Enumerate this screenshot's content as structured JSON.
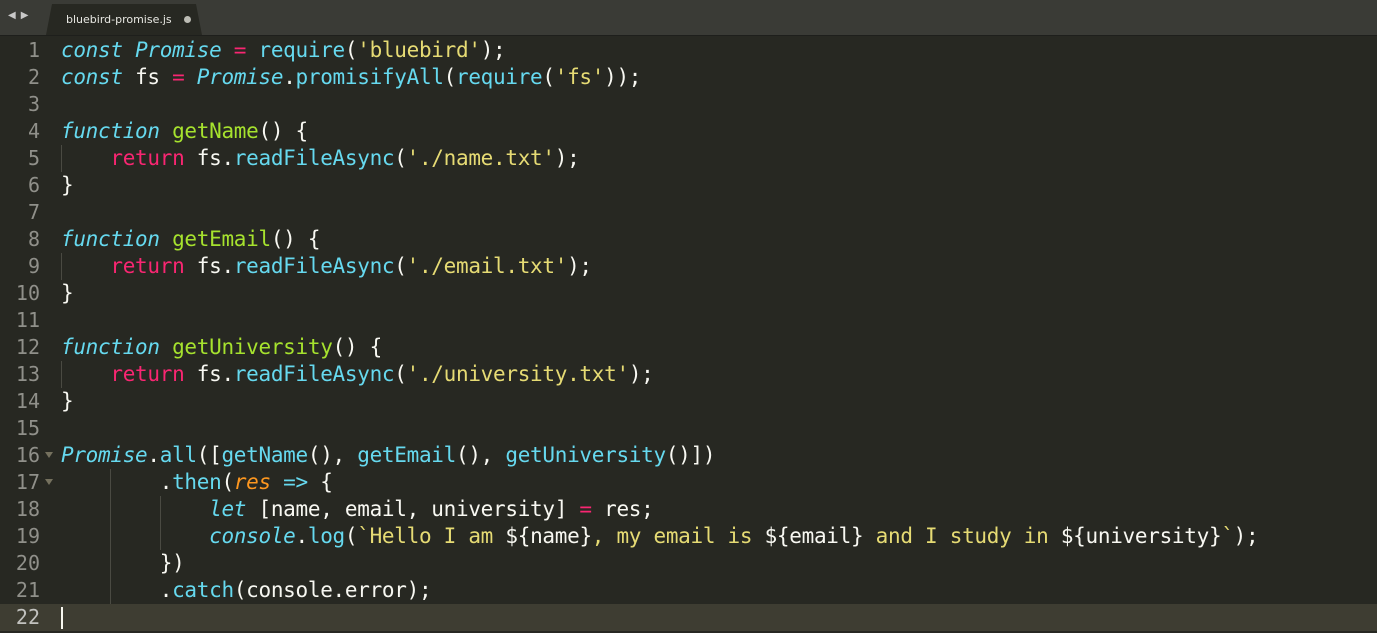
{
  "tabbar": {
    "nav_left_icon": "arrow-left-icon",
    "nav_right_icon": "arrow-right-icon",
    "tab_label": "bluebird-promise.js",
    "dirty_indicator_icon": "unsaved-dot-icon"
  },
  "theme": {
    "background": "#272822",
    "keyword": "#66d9ef",
    "control": "#f92672",
    "string": "#e6db74",
    "function": "#a6e22e",
    "parameter": "#fd971f",
    "text": "#f8f8f2"
  },
  "editor": {
    "current_line": 22,
    "lines": [
      {
        "number": "1",
        "indent": 0,
        "tokens": [
          [
            "const ",
            "kw"
          ],
          [
            "Promise",
            "sup"
          ],
          [
            " = ",
            "op"
          ],
          [
            "require",
            "fn"
          ],
          [
            "(",
            "p"
          ],
          [
            "'bluebird'",
            "str"
          ],
          [
            ");",
            "p"
          ]
        ]
      },
      {
        "number": "2",
        "indent": 0,
        "tokens": [
          [
            "const ",
            "kw"
          ],
          [
            "fs",
            "p"
          ],
          [
            " = ",
            "op"
          ],
          [
            "Promise",
            "sup"
          ],
          [
            ".",
            "p"
          ],
          [
            "promisifyAll",
            "fn"
          ],
          [
            "(",
            "p"
          ],
          [
            "require",
            "fn"
          ],
          [
            "(",
            "p"
          ],
          [
            "'fs'",
            "str"
          ],
          [
            "));",
            "p"
          ]
        ]
      },
      {
        "number": "3",
        "indent": 0,
        "tokens": []
      },
      {
        "number": "4",
        "indent": 0,
        "tokens": [
          [
            "function ",
            "kw"
          ],
          [
            "getName",
            "def"
          ],
          [
            "() {",
            "p"
          ]
        ]
      },
      {
        "number": "5",
        "indent": 1,
        "tokens": [
          [
            "    ",
            "p"
          ],
          [
            "return ",
            "ctl"
          ],
          [
            "fs",
            "p"
          ],
          [
            ".",
            "p"
          ],
          [
            "readFileAsync",
            "fn"
          ],
          [
            "(",
            "p"
          ],
          [
            "'./name.txt'",
            "str"
          ],
          [
            ");",
            "p"
          ]
        ]
      },
      {
        "number": "6",
        "indent": 0,
        "tokens": [
          [
            "}",
            "p"
          ]
        ]
      },
      {
        "number": "7",
        "indent": 0,
        "tokens": []
      },
      {
        "number": "8",
        "indent": 0,
        "tokens": [
          [
            "function ",
            "kw"
          ],
          [
            "getEmail",
            "def"
          ],
          [
            "() {",
            "p"
          ]
        ]
      },
      {
        "number": "9",
        "indent": 1,
        "tokens": [
          [
            "    ",
            "p"
          ],
          [
            "return ",
            "ctl"
          ],
          [
            "fs",
            "p"
          ],
          [
            ".",
            "p"
          ],
          [
            "readFileAsync",
            "fn"
          ],
          [
            "(",
            "p"
          ],
          [
            "'./email.txt'",
            "str"
          ],
          [
            ");",
            "p"
          ]
        ]
      },
      {
        "number": "10",
        "indent": 0,
        "tokens": [
          [
            "}",
            "p"
          ]
        ]
      },
      {
        "number": "11",
        "indent": 0,
        "tokens": []
      },
      {
        "number": "12",
        "indent": 0,
        "tokens": [
          [
            "function ",
            "kw"
          ],
          [
            "getUniversity",
            "def"
          ],
          [
            "() {",
            "p"
          ]
        ]
      },
      {
        "number": "13",
        "indent": 1,
        "tokens": [
          [
            "    ",
            "p"
          ],
          [
            "return ",
            "ctl"
          ],
          [
            "fs",
            "p"
          ],
          [
            ".",
            "p"
          ],
          [
            "readFileAsync",
            "fn"
          ],
          [
            "(",
            "p"
          ],
          [
            "'./university.txt'",
            "str"
          ],
          [
            ");",
            "p"
          ]
        ]
      },
      {
        "number": "14",
        "indent": 0,
        "tokens": [
          [
            "}",
            "p"
          ]
        ]
      },
      {
        "number": "15",
        "indent": 0,
        "tokens": []
      },
      {
        "number": "16",
        "indent": 0,
        "fold": true,
        "tokens": [
          [
            "Promise",
            "sup"
          ],
          [
            ".",
            "p"
          ],
          [
            "all",
            "fn"
          ],
          [
            "([",
            "p"
          ],
          [
            "getName",
            "fn"
          ],
          [
            "(), ",
            "p"
          ],
          [
            "getEmail",
            "fn"
          ],
          [
            "(), ",
            "p"
          ],
          [
            "getUniversity",
            "fn"
          ],
          [
            "()])",
            "p"
          ]
        ]
      },
      {
        "number": "17",
        "indent": 1,
        "fold": true,
        "tokens": [
          [
            "        ",
            "p"
          ],
          [
            ".",
            "p"
          ],
          [
            "then",
            "fn"
          ],
          [
            "(",
            "p"
          ],
          [
            "res",
            "param"
          ],
          [
            " => ",
            "kw"
          ],
          [
            "{",
            "p"
          ]
        ]
      },
      {
        "number": "18",
        "indent": 2,
        "tokens": [
          [
            "            ",
            "p"
          ],
          [
            "let ",
            "kw"
          ],
          [
            "[name, email, university] ",
            "p"
          ],
          [
            "= ",
            "op"
          ],
          [
            "res;",
            "p"
          ]
        ]
      },
      {
        "number": "19",
        "indent": 2,
        "tokens": [
          [
            "            ",
            "p"
          ],
          [
            "console",
            "sup"
          ],
          [
            ".",
            "p"
          ],
          [
            "log",
            "fn"
          ],
          [
            "(",
            "p"
          ],
          [
            "`Hello I am ",
            "str"
          ],
          [
            "${",
            "p"
          ],
          [
            "name",
            "p"
          ],
          [
            "}",
            "p"
          ],
          [
            ", my email is ",
            "str"
          ],
          [
            "${",
            "p"
          ],
          [
            "email",
            "p"
          ],
          [
            "}",
            "p"
          ],
          [
            " and I study in ",
            "str"
          ],
          [
            "${",
            "p"
          ],
          [
            "university",
            "p"
          ],
          [
            "}",
            "p"
          ],
          [
            "`",
            "str"
          ],
          [
            ");",
            "p"
          ]
        ]
      },
      {
        "number": "20",
        "indent": 1,
        "tokens": [
          [
            "        ",
            "p"
          ],
          [
            "})",
            "p"
          ]
        ]
      },
      {
        "number": "21",
        "indent": 1,
        "tokens": [
          [
            "        ",
            "p"
          ],
          [
            ".",
            "p"
          ],
          [
            "catch",
            "fn"
          ],
          [
            "(console.error);",
            "p"
          ]
        ]
      },
      {
        "number": "22",
        "indent": 0,
        "tokens": []
      }
    ]
  }
}
